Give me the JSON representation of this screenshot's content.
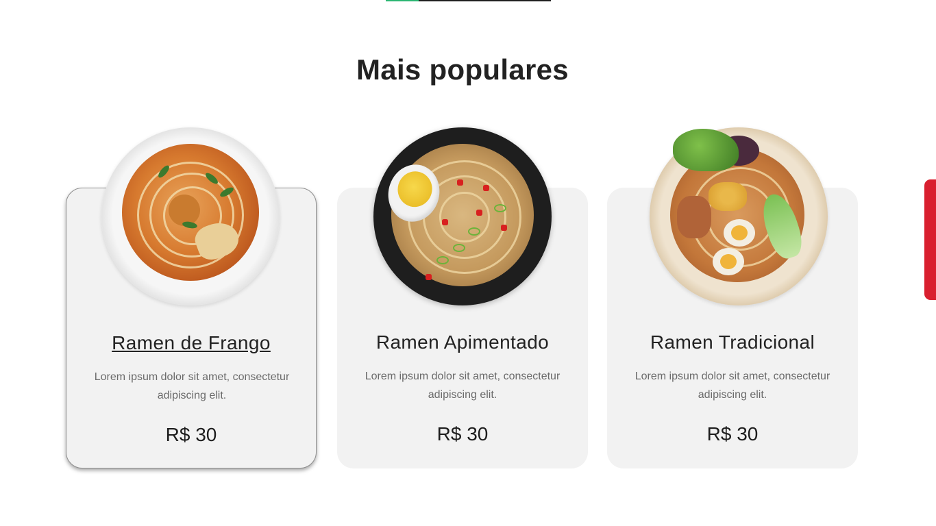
{
  "section": {
    "title": "Mais populares"
  },
  "colors": {
    "accent_green": "#2bb673",
    "side_tab_red": "#d91f2f",
    "card_bg": "#f2f2f2"
  },
  "cards": [
    {
      "name": "Ramen de Frango",
      "description": "Lorem ipsum dolor sit amet, consectetur adipiscing elit.",
      "price": "R$ 30",
      "image": "chicken-ramen-bowl-image",
      "state": "hovered"
    },
    {
      "name": "Ramen Apimentado",
      "description": "Lorem ipsum dolor sit amet, consectetur adipiscing elit.",
      "price": "R$ 30",
      "image": "spicy-ramen-bowl-image",
      "state": "default"
    },
    {
      "name": "Ramen Tradicional",
      "description": "Lorem ipsum dolor sit amet, consectetur adipiscing elit.",
      "price": "R$ 30",
      "image": "traditional-ramen-bowl-image",
      "state": "default"
    }
  ]
}
